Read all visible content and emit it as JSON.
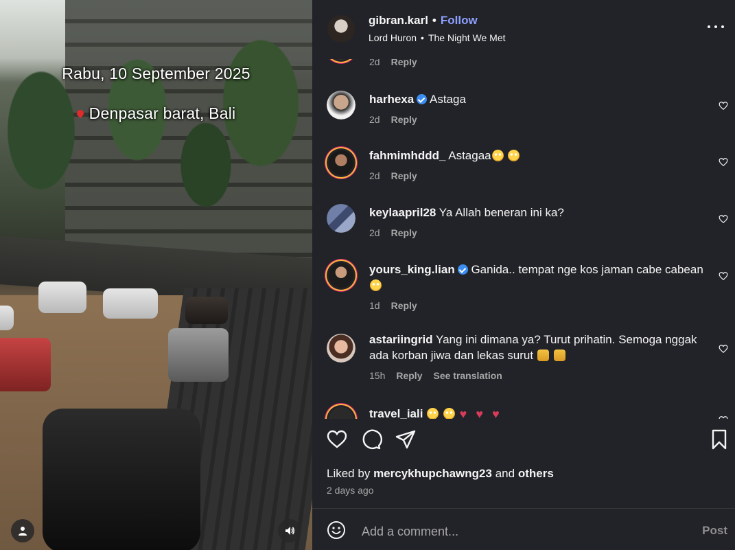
{
  "media": {
    "overlay_date": "Rabu, 10 September 2025",
    "overlay_location": "Denpasar barat, Bali",
    "icons": {
      "pin": "location-pin-icon",
      "user": "user-tag-icon",
      "sound": "speaker-icon"
    }
  },
  "header": {
    "username": "gibran.karl",
    "dot": "•",
    "follow_label": "Follow",
    "artist": "Lord Huron",
    "song": "The Night We Met",
    "bullet": "•",
    "accent_color": "#8ea0ff"
  },
  "comments": [
    {
      "user": "",
      "text": "",
      "time": "2d",
      "reply": "Reply",
      "partial_top": true
    },
    {
      "user": "harhexa",
      "verified": true,
      "text": "Astaga",
      "time": "2d",
      "reply": "Reply"
    },
    {
      "user": "fahmimhddd_",
      "verified": false,
      "text": "Astagaa",
      "time": "2d",
      "reply": "Reply"
    },
    {
      "user": "keylaapril28",
      "verified": false,
      "text": "Ya Allah beneran ini ka?",
      "time": "2d",
      "reply": "Reply"
    },
    {
      "user": "yours_king.lian",
      "verified": true,
      "text": "Ganida.. tempat nge kos jaman cabe cabean",
      "time": "1d",
      "reply": "Reply"
    },
    {
      "user": "astariingrid",
      "verified": false,
      "text": "Yang ini dimana ya? Turut prihatin. Semoga nggak ada korban jiwa dan lekas surut",
      "time": "15h",
      "reply": "Reply",
      "translate": "See translation"
    },
    {
      "user": "travel_iali",
      "verified": false,
      "text": ""
    }
  ],
  "likes": {
    "prefix": "Liked by",
    "user": "mercykhupchawng23",
    "joiner": "and",
    "others": "others",
    "time_ago": "2 days ago"
  },
  "composer": {
    "placeholder": "Add a comment...",
    "post_label": "Post"
  },
  "colors": {
    "panel_bg": "#212328",
    "muted": "#a8a8a8",
    "verified": "#3b8df0"
  }
}
